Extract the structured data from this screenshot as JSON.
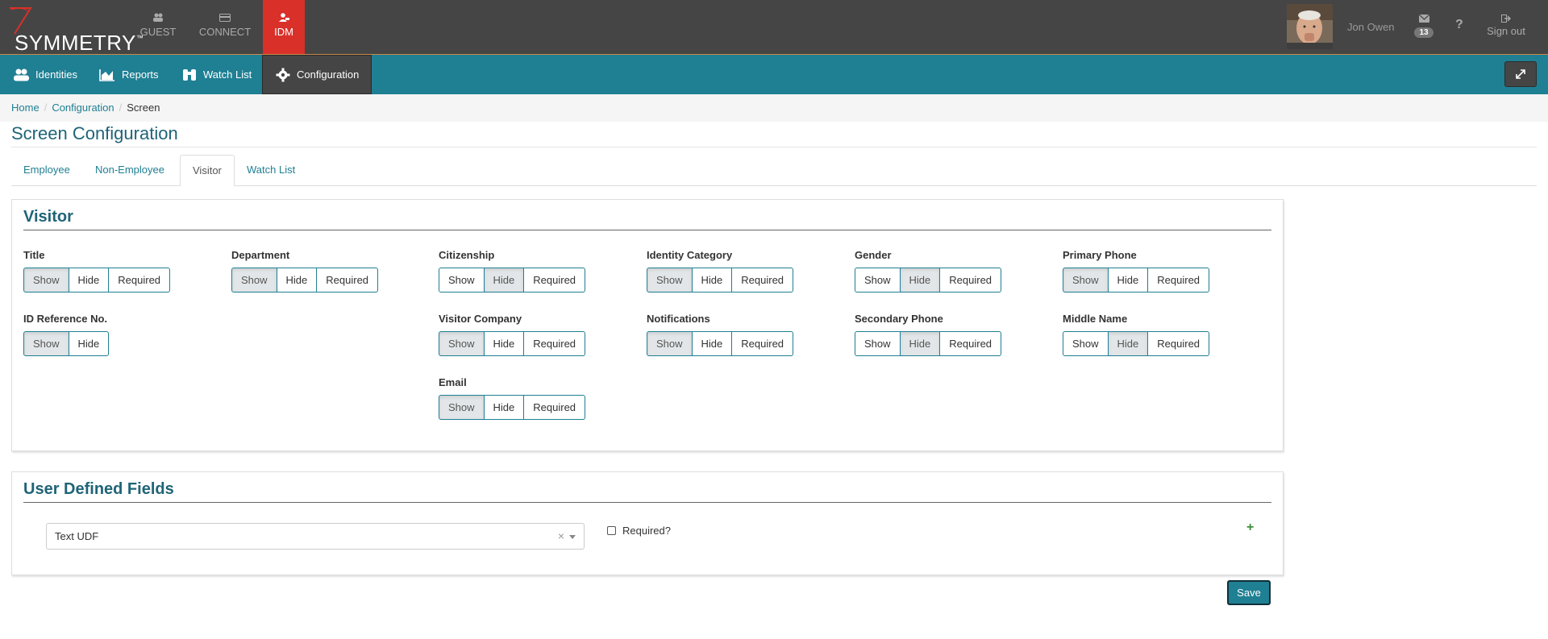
{
  "brand": {
    "name": "SYMMETRY",
    "tm": "™"
  },
  "modules": [
    {
      "label": "GUEST",
      "icon": "users-icon"
    },
    {
      "label": "CONNECT",
      "icon": "card-icon"
    },
    {
      "label": "IDM",
      "icon": "user-badge-icon",
      "active": true
    }
  ],
  "user": {
    "name": "Jon Owen",
    "mail_count": "13",
    "help": "?",
    "signout": "Sign out"
  },
  "nav": {
    "items": [
      {
        "label": "Identities",
        "icon": "users-icon"
      },
      {
        "label": "Reports",
        "icon": "area-chart-icon"
      },
      {
        "label": "Watch List",
        "icon": "binoculars-icon"
      },
      {
        "label": "Configuration",
        "icon": "gear-icon",
        "active": true
      }
    ]
  },
  "breadcrumb": {
    "home": "Home",
    "config": "Configuration",
    "current": "Screen"
  },
  "page": {
    "title": "Screen Configuration"
  },
  "tabs": [
    {
      "label": "Employee"
    },
    {
      "label": "Non-Employee"
    },
    {
      "label": "Visitor",
      "active": true
    },
    {
      "label": "Watch List"
    }
  ],
  "visitor": {
    "title": "Visitor",
    "options": {
      "show": "Show",
      "hide": "Hide",
      "required": "Required"
    },
    "fields": {
      "title": {
        "label": "Title",
        "selected": "Show"
      },
      "department": {
        "label": "Department",
        "selected": "Show"
      },
      "citizenship": {
        "label": "Citizenship",
        "selected": "Hide"
      },
      "identity_category": {
        "label": "Identity Category",
        "selected": "Show"
      },
      "gender": {
        "label": "Gender",
        "selected": "Hide"
      },
      "primary_phone": {
        "label": "Primary Phone",
        "selected": "Show"
      },
      "id_reference": {
        "label": "ID Reference No.",
        "selected": "Show"
      },
      "visitor_company": {
        "label": "Visitor Company",
        "selected": "Show"
      },
      "notifications": {
        "label": "Notifications",
        "selected": "Show"
      },
      "secondary_phone": {
        "label": "Secondary Phone",
        "selected": "Hide"
      },
      "middle_name": {
        "label": "Middle Name",
        "selected": "Hide"
      },
      "email": {
        "label": "Email",
        "selected": "Show"
      }
    }
  },
  "udf": {
    "title": "User Defined Fields",
    "selected_value": "Text UDF",
    "clear": "×",
    "required_label": "Required?",
    "add": "+"
  },
  "actions": {
    "save": "Save"
  },
  "colors": {
    "topbar": "#454545",
    "navbar": "#1f7f93",
    "accent": "#1f6478",
    "module_active": "#d9302a"
  }
}
